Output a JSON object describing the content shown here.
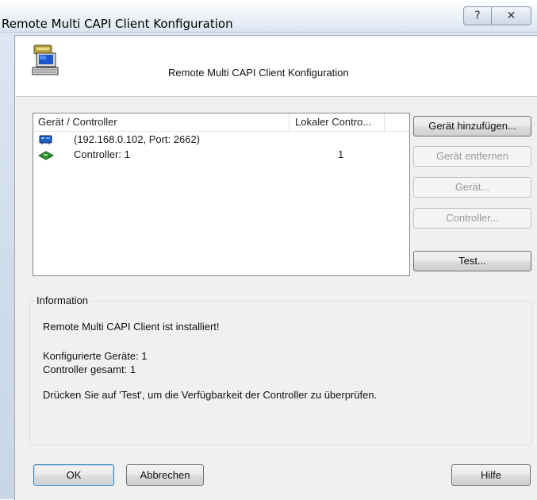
{
  "window": {
    "title": "Remote Multi CAPI Client Konfiguration",
    "help_glyph": "?",
    "close_glyph": "✕"
  },
  "header": {
    "title": "Remote Multi CAPI Client Konfiguration",
    "icon": "telephone-computer-icon"
  },
  "device_list": {
    "columns": [
      "Gerät / Controller",
      "Lokaler Contro..."
    ],
    "rows": [
      {
        "icon": "network-device-icon",
        "label": "(192.168.0.102, Port: 2662)",
        "local_controller": ""
      },
      {
        "icon": "controller-card-icon",
        "label": "Controller: 1",
        "local_controller": "1"
      }
    ]
  },
  "side_buttons": {
    "add_device": "Gerät hinzufügen...",
    "remove_device": "Gerät entfernen",
    "device": "Gerät...",
    "controller": "Controller...",
    "test": "Test..."
  },
  "information": {
    "legend": "Information",
    "installed": "Remote Multi CAPI Client ist installiert!",
    "configured_devices": "Konfigurierte Geräte: 1",
    "controllers_total": "Controller gesamt: 1",
    "hint": "Drücken Sie auf 'Test', um die Verfügbarkeit der Controller zu überprüfen."
  },
  "footer": {
    "ok": "OK",
    "cancel": "Abbrechen",
    "help": "Hilfe"
  },
  "colors": {
    "title_bar": "#dbe5f1",
    "dialog_background": "#f0f0f0",
    "disabled_text": "#9a9a9a",
    "default_button_border": "#3c7fb1"
  }
}
